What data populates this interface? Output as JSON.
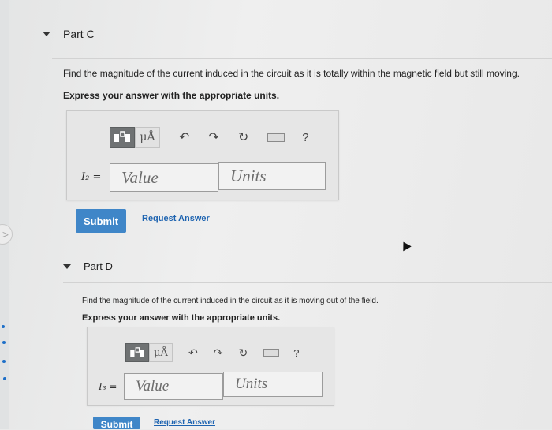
{
  "colors": {
    "accent": "#3f86c8",
    "link": "#1d63b0",
    "background": "#e9eaea"
  },
  "part_c": {
    "title": "Part C",
    "question": "Find the magnitude of the current induced in the circuit as it is totally within the magnetic field but still moving.",
    "instruction": "Express your answer with the appropriate units.",
    "toolbar": {
      "template_icon": "fraction-template-icon",
      "units_label": "μÅ",
      "undo_icon": "undo-icon",
      "redo_icon": "redo-icon",
      "reset_icon": "reset-icon",
      "keyboard_icon": "keyboard-icon",
      "help_label": "?"
    },
    "variable": "I₂ =",
    "value_placeholder": "Value",
    "units_placeholder": "Units",
    "submit_label": "Submit",
    "request_answer_label": "Request Answer"
  },
  "part_d": {
    "title": "Part D",
    "question": "Find the magnitude of the current induced in the circuit as it is moving out of the field.",
    "instruction": "Express your answer with the appropriate units.",
    "toolbar": {
      "template_icon": "fraction-template-icon",
      "units_label": "μÅ",
      "undo_icon": "undo-icon",
      "redo_icon": "redo-icon",
      "reset_icon": "reset-icon",
      "keyboard_icon": "keyboard-icon",
      "help_label": "?"
    },
    "variable": "I₃ =",
    "value_placeholder": "Value",
    "units_placeholder": "Units",
    "submit_label": "Submit",
    "request_answer_label": "Request Answer"
  }
}
